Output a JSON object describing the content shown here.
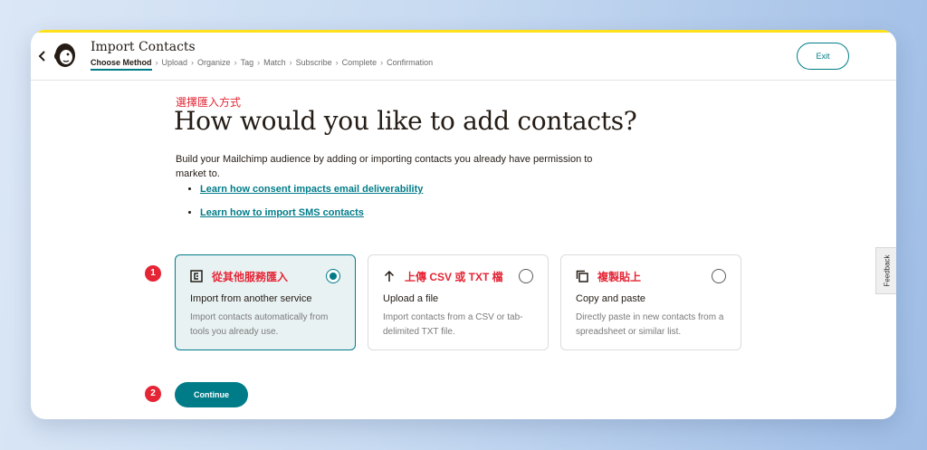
{
  "header": {
    "title": "Import Contacts",
    "exit_label": "Exit",
    "steps": [
      "Choose Method",
      "Upload",
      "Organize",
      "Tag",
      "Match",
      "Subscribe",
      "Complete",
      "Confirmation"
    ],
    "active_step": "Choose Method"
  },
  "content": {
    "zh_heading": "選擇匯入方式",
    "heading": "How would you like to add contacts?",
    "description": "Build your Mailchimp audience by adding or importing contacts you already have permission to market to.",
    "links": [
      "Learn how consent impacts email deliverability",
      "Learn how to import SMS contacts"
    ]
  },
  "badges": [
    "1",
    "2"
  ],
  "options": [
    {
      "zh_label": "從其他服務匯入",
      "title": "Import from another service",
      "description": "Import contacts automatically from tools you already use.",
      "selected": true,
      "icon": "import-service-icon"
    },
    {
      "zh_label": "上傳 CSV 或 TXT 檔",
      "title": "Upload a file",
      "description": "Import contacts from a CSV or tab-delimited TXT file.",
      "selected": false,
      "icon": "upload-arrow-icon"
    },
    {
      "zh_label": "複製貼上",
      "title": "Copy and paste",
      "description": "Directly paste in new contacts from a spreadsheet or similar list.",
      "selected": false,
      "icon": "copy-icon"
    }
  ],
  "continue_label": "Continue",
  "feedback_label": "Feedback",
  "colors": {
    "accent": "#007c89",
    "annotation": "#e52535",
    "brand_yellow": "#ffe01b",
    "text": "#241c15"
  }
}
